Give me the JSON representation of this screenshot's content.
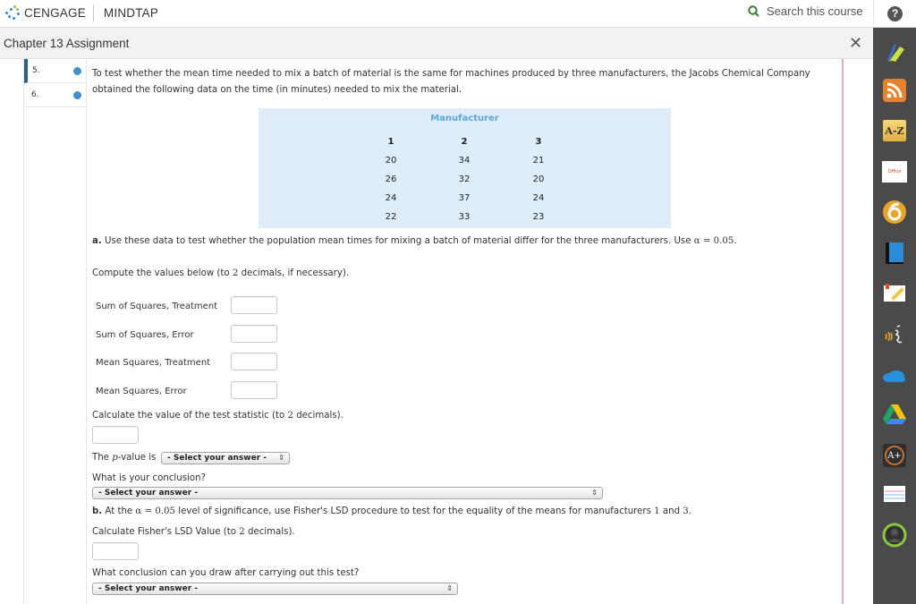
{
  "header": {
    "brand": "CENGAGE",
    "product": "MINDTAP",
    "search_placeholder": "Search this course",
    "help_label": "?"
  },
  "titlebar": {
    "title": "Chapter 13 Assignment",
    "close_label": "✕"
  },
  "question_nav": [
    {
      "number": "5.",
      "active": true
    },
    {
      "number": "6.",
      "active": false
    }
  ],
  "question": {
    "intro_line1": "To test whether the mean time needed to mix a batch of material is the same for machines produced by three manufacturers, the Jacobs Chemical Company",
    "intro_line2": "obtained the following data on the time (in minutes) needed to mix the material.",
    "table": {
      "title": "Manufacturer",
      "headers": [
        "1",
        "2",
        "3"
      ],
      "rows": [
        [
          "20",
          "34",
          "21"
        ],
        [
          "26",
          "32",
          "20"
        ],
        [
          "24",
          "37",
          "24"
        ],
        [
          "22",
          "33",
          "23"
        ]
      ]
    },
    "part_a_label": "a.",
    "part_a_text": "Use these data to test whether the population mean times for mixing a batch of material differ for the three manufacturers. Use",
    "alpha_expr": "α = 0.05",
    "period": ".",
    "compute_prefix": "Compute the values below (to",
    "compute_num": "2",
    "compute_suffix": "decimals, if necessary).",
    "fields": [
      {
        "label": "Sum of Squares, Treatment",
        "value": ""
      },
      {
        "label": "Sum of Squares, Error",
        "value": ""
      },
      {
        "label": "Mean Squares, Treatment",
        "value": ""
      },
      {
        "label": "Mean Squares, Error",
        "value": ""
      }
    ],
    "test_stat_prefix": "Calculate the value of the test statistic (to",
    "test_stat_num": "2",
    "test_stat_suffix": "decimals).",
    "test_stat_value": "",
    "pvalue_prefix": "The",
    "pvalue_var": "p",
    "pvalue_suffix": "-value is",
    "pvalue_select": "- Select your answer -",
    "conclusion_label": "What is your conclusion?",
    "conclusion_select": "- Select your answer -",
    "part_b_label": "b.",
    "part_b_prefix": "At the",
    "part_b_alpha": "α = 0.05",
    "part_b_mid": "level of significance, use Fisher's LSD procedure to test for the equality of the means for manufacturers",
    "part_b_m1": "1",
    "part_b_and": "and",
    "part_b_m2": "3",
    "lsd_prefix": "Calculate Fisher's LSD Value (to",
    "lsd_num": "2",
    "lsd_suffix": "decimals).",
    "lsd_value": "",
    "lsd_conclusion_label": "What conclusion can you draw after carrying out this test?",
    "lsd_conclusion_select": "- Select your answer -"
  },
  "rail_icons": [
    "highlighter-icon",
    "rss-icon",
    "az-glossary-icon",
    "office-icon",
    "pearltrees-icon",
    "book-icon",
    "notes-icon",
    "readspeaker-icon",
    "onedrive-icon",
    "google-drive-icon",
    "aplus-icon",
    "notebook-icon",
    "profile-icon"
  ],
  "rail_labels": {
    "az": "A-Z",
    "office": "Office",
    "aplus": "A+"
  },
  "colors": {
    "accent_blue": "#3f8fd0",
    "table_bg": "#deedf9",
    "table_title": "#5ba6dc",
    "rail_bg": "#4a4a4a",
    "search_icon": "#3a7d3a"
  }
}
